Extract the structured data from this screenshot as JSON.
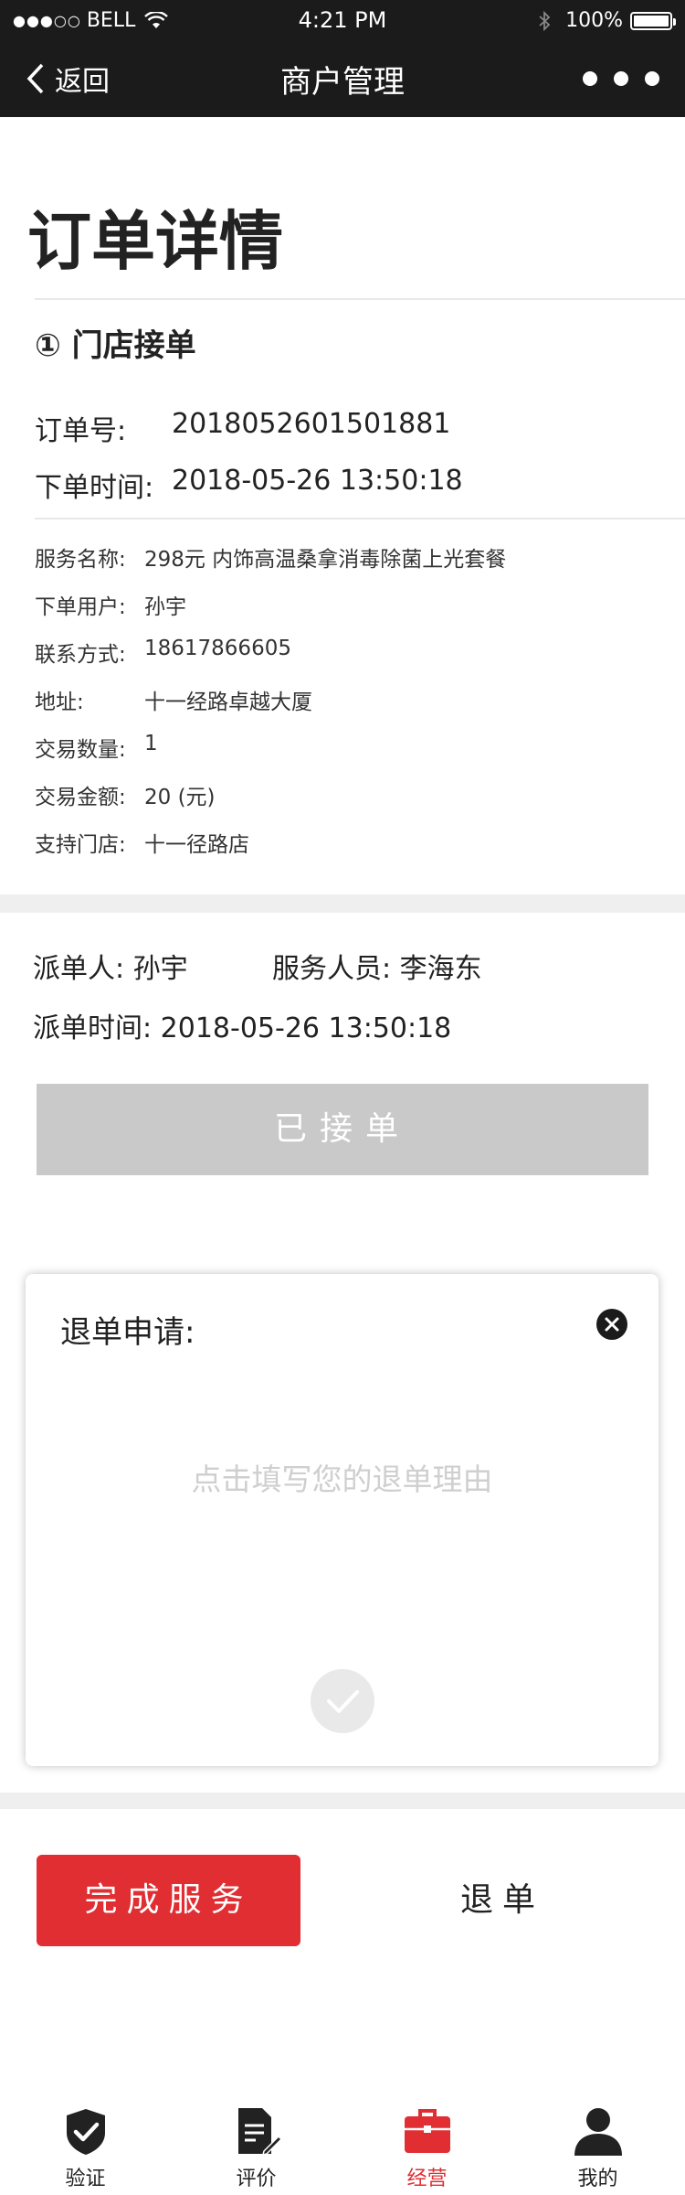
{
  "status_bar": {
    "signal": "●●●○○",
    "carrier": "BELL",
    "time": "4:21 PM",
    "battery": "100%",
    "battery_level": 1.0
  },
  "nav": {
    "back_label": "返回",
    "title": "商户管理"
  },
  "page_title": "订单详情",
  "step_label": "① 门店接单",
  "order": {
    "number_label": "订单号:",
    "number": "2018052601501881",
    "time_label": "下单时间:",
    "time": "2018-05-26 13:50:18"
  },
  "details": [
    {
      "label": "服务名称:",
      "value": "298元 内饰高温桑拿消毒除菌上光套餐"
    },
    {
      "label": "下单用户:",
      "value": "孙宇"
    },
    {
      "label": "联系方式:",
      "value": "18617866605"
    },
    {
      "label": "地址:",
      "value": "十一经路卓越大厦"
    },
    {
      "label": "交易数量:",
      "value": "1"
    },
    {
      "label": "交易金额:",
      "value": "20 (元)"
    },
    {
      "label": "支持门店:",
      "value": "十一径路店"
    }
  ],
  "dispatch": {
    "dispatcher": "派单人: 孙宇",
    "staff": "服务人员: 李海东",
    "time": "派单时间: 2018-05-26 13:50:18"
  },
  "accepted_button": "已接单",
  "refund_modal": {
    "title": "退单申请:",
    "placeholder": "点击填写您的退单理由"
  },
  "actions": {
    "complete": "完成服务",
    "refund": "退单"
  },
  "tabbar": [
    {
      "label": "验证",
      "icon": "shield-check-icon",
      "active": false
    },
    {
      "label": "评价",
      "icon": "document-pen-icon",
      "active": false
    },
    {
      "label": "经营",
      "icon": "briefcase-icon",
      "active": true
    },
    {
      "label": "我的",
      "icon": "user-icon",
      "active": false
    }
  ],
  "colors": {
    "accent": "#e02e32",
    "header_bg": "#1b1b1b",
    "disabled": "#c9c9c9"
  }
}
